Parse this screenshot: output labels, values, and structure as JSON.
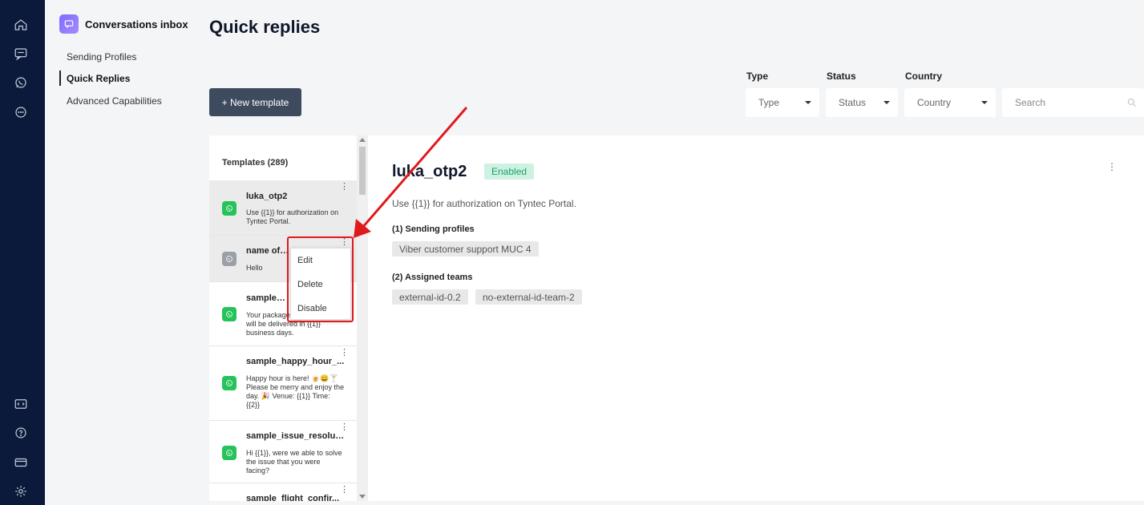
{
  "rail": {
    "top_icons": [
      "home-icon",
      "inbox-icon",
      "whatsapp-icon",
      "chat-icon"
    ],
    "bottom_icons": [
      "code-icon",
      "help-icon",
      "billing-icon",
      "settings-icon"
    ]
  },
  "sidebar": {
    "title": "Conversations inbox",
    "items": [
      {
        "label": "Sending Profiles",
        "active": false
      },
      {
        "label": "Quick Replies",
        "active": true
      },
      {
        "label": "Advanced Capabilities",
        "active": false
      }
    ]
  },
  "page": {
    "title": "Quick replies",
    "new_button": "+ New template"
  },
  "filters": {
    "type": {
      "label": "Type",
      "value": "Type"
    },
    "status": {
      "label": "Status",
      "value": "Status"
    },
    "country": {
      "label": "Country",
      "value": "Country"
    },
    "search_placeholder": "Search"
  },
  "templates": {
    "header": "Templates (289)",
    "items": [
      {
        "name": "luka_otp2",
        "text": "Use {{1}} for authorization on Tyntec Portal.",
        "channel": "whatsapp",
        "selected": true
      },
      {
        "name": "name of th",
        "text": "Hello",
        "channel": "viber",
        "selected": true
      },
      {
        "name": "sample_sh",
        "text": "Your package … shipped. It will be delivered in {{1}} business days.",
        "channel": "whatsapp",
        "selected": false
      },
      {
        "name": "sample_happy_hour_...",
        "text": "Happy hour is here! 🍺😀🍸 Please be merry and enjoy the day. 🎉 Venue: {{1}} Time: {{2}}",
        "channel": "whatsapp",
        "selected": false
      },
      {
        "name": "sample_issue_resolut...",
        "text": "Hi {{1}}, were we able to solve the issue that you were facing?",
        "channel": "whatsapp",
        "selected": false
      },
      {
        "name": "sample_flight_confir...",
        "text": "",
        "channel": "whatsapp",
        "selected": false
      }
    ]
  },
  "context_menu": {
    "items": [
      "Edit",
      "Delete",
      "Disable"
    ]
  },
  "detail": {
    "title": "luka_otp2",
    "status": "Enabled",
    "description": "Use {{1}} for authorization on Tyntec Portal.",
    "sending_profiles_header": "(1) Sending profiles",
    "sending_profiles": [
      "Viber customer support MUC 4"
    ],
    "teams_header": "(2) Assigned teams",
    "teams": [
      "external-id-0.2",
      "no-external-id-team-2"
    ]
  },
  "colors": {
    "rail": "#0b1a3a",
    "primary_button": "#3e4b5e",
    "enabled_badge_bg": "#cdf2e2",
    "annotation": "#e0191d",
    "whatsapp": "#25c35a"
  }
}
